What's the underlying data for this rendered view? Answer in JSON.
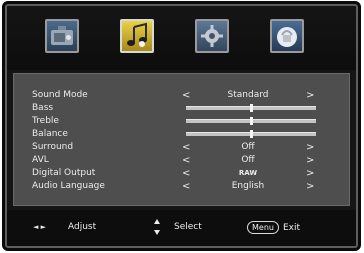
{
  "tabs": [
    {
      "name": "picture-icon",
      "active": false
    },
    {
      "name": "sound-icon",
      "active": true
    },
    {
      "name": "settings-icon",
      "active": false
    },
    {
      "name": "lock-icon",
      "active": false
    }
  ],
  "settings": {
    "sound_mode": {
      "label": "Sound Mode",
      "value": "Standard"
    },
    "bass": {
      "label": "Bass",
      "level": 0.5
    },
    "treble": {
      "label": "Treble",
      "level": 0.5
    },
    "balance": {
      "label": "Balance",
      "level": 0.5
    },
    "surround": {
      "label": "Surround",
      "value": "Off"
    },
    "avl": {
      "label": "AVL",
      "value": "Off"
    },
    "digital_output": {
      "label": "Digital Output",
      "value": "RAW"
    },
    "audio_language": {
      "label": "Audio Language",
      "value": "English"
    }
  },
  "arrows": {
    "left": "<",
    "right": ">"
  },
  "footer": {
    "adjust_icon": "◄ ►",
    "adjust_label": "Adjust",
    "select_label": "Select",
    "menu_key": "Menu",
    "exit_label": "Exit"
  }
}
